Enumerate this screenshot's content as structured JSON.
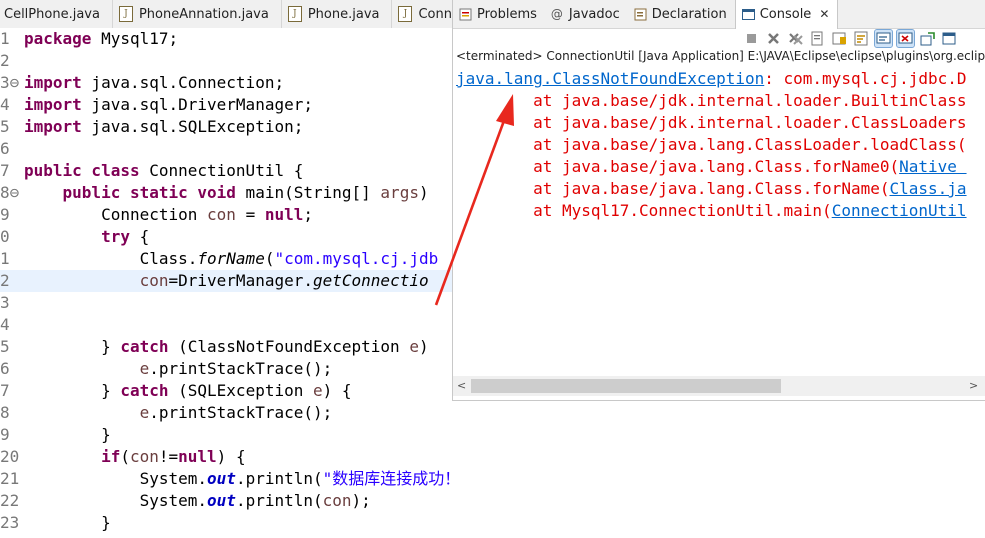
{
  "editor_tabs": [
    "CellPhone.java",
    "PhoneAnnation.java",
    "Phone.java",
    "Conne"
  ],
  "code_lines": [
    {
      "num": "1",
      "html_parts": [
        {
          "t": "kw",
          "v": "package"
        },
        {
          "t": "",
          "v": " Mysql17;"
        }
      ]
    },
    {
      "num": "2",
      "html_parts": []
    },
    {
      "num": "3⊖",
      "html_parts": [
        {
          "t": "kw",
          "v": "import"
        },
        {
          "t": "",
          "v": " java.sql.Connection;"
        }
      ]
    },
    {
      "num": "4",
      "html_parts": [
        {
          "t": "kw",
          "v": "import"
        },
        {
          "t": "",
          "v": " java.sql.DriverManager;"
        }
      ]
    },
    {
      "num": "5",
      "html_parts": [
        {
          "t": "kw",
          "v": "import"
        },
        {
          "t": "",
          "v": " java.sql.SQLException;"
        }
      ]
    },
    {
      "num": "6",
      "html_parts": []
    },
    {
      "num": "7",
      "html_parts": [
        {
          "t": "kw",
          "v": "public class"
        },
        {
          "t": "",
          "v": " ConnectionUtil {"
        }
      ]
    },
    {
      "num": "8⊖",
      "html_parts": [
        {
          "t": "",
          "v": "    "
        },
        {
          "t": "kw",
          "v": "public static void"
        },
        {
          "t": "",
          "v": " main(String[] "
        },
        {
          "t": "var",
          "v": "args"
        },
        {
          "t": "",
          "v": ")"
        }
      ]
    },
    {
      "num": "9",
      "html_parts": [
        {
          "t": "",
          "v": "        Connection "
        },
        {
          "t": "var",
          "v": "con"
        },
        {
          "t": "",
          "v": " = "
        },
        {
          "t": "kw",
          "v": "null"
        },
        {
          "t": "",
          "v": ";"
        }
      ]
    },
    {
      "num": "0",
      "html_parts": [
        {
          "t": "",
          "v": "        "
        },
        {
          "t": "kw",
          "v": "try"
        },
        {
          "t": "",
          "v": " {"
        }
      ]
    },
    {
      "num": "1",
      "html_parts": [
        {
          "t": "",
          "v": "            Class."
        },
        {
          "t": "it",
          "v": "forName"
        },
        {
          "t": "",
          "v": "("
        },
        {
          "t": "str",
          "v": "\"com.mysql.cj.jdb"
        }
      ]
    },
    {
      "num": "2",
      "html_parts": [
        {
          "t": "",
          "v": "            "
        },
        {
          "t": "var",
          "v": "con"
        },
        {
          "t": "",
          "v": "=DriverManager."
        },
        {
          "t": "it",
          "v": "getConnectio"
        }
      ],
      "current": true
    },
    {
      "num": "3",
      "html_parts": []
    },
    {
      "num": "4",
      "html_parts": []
    },
    {
      "num": "5",
      "html_parts": [
        {
          "t": "",
          "v": "        } "
        },
        {
          "t": "kw",
          "v": "catch"
        },
        {
          "t": "",
          "v": " (ClassNotFoundException "
        },
        {
          "t": "var",
          "v": "e"
        },
        {
          "t": "",
          "v": ")"
        }
      ]
    },
    {
      "num": "6",
      "html_parts": [
        {
          "t": "",
          "v": "            "
        },
        {
          "t": "var",
          "v": "e"
        },
        {
          "t": "",
          "v": ".printStackTrace();"
        }
      ]
    },
    {
      "num": "7",
      "html_parts": [
        {
          "t": "",
          "v": "        } "
        },
        {
          "t": "kw",
          "v": "catch"
        },
        {
          "t": "",
          "v": " (SQLException "
        },
        {
          "t": "var",
          "v": "e"
        },
        {
          "t": "",
          "v": ") {"
        }
      ]
    },
    {
      "num": "8",
      "html_parts": [
        {
          "t": "",
          "v": "            "
        },
        {
          "t": "var",
          "v": "e"
        },
        {
          "t": "",
          "v": ".printStackTrace();"
        }
      ]
    },
    {
      "num": "9",
      "html_parts": [
        {
          "t": "",
          "v": "        }"
        }
      ]
    },
    {
      "num": "20",
      "html_parts": [
        {
          "t": "",
          "v": "        "
        },
        {
          "t": "kw",
          "v": "if"
        },
        {
          "t": "",
          "v": "("
        },
        {
          "t": "var",
          "v": "con"
        },
        {
          "t": "",
          "v": "!="
        },
        {
          "t": "kw",
          "v": "null"
        },
        {
          "t": "",
          "v": ") {"
        }
      ]
    },
    {
      "num": "21",
      "html_parts": [
        {
          "t": "",
          "v": "            System."
        },
        {
          "t": "fld",
          "v": "out"
        },
        {
          "t": "",
          "v": ".println("
        },
        {
          "t": "str",
          "v": "\"数据库连接成功！\""
        },
        {
          "t": "",
          "v": ");"
        }
      ]
    },
    {
      "num": "22",
      "html_parts": [
        {
          "t": "",
          "v": "            System."
        },
        {
          "t": "fld",
          "v": "out"
        },
        {
          "t": "",
          "v": ".println("
        },
        {
          "t": "var",
          "v": "con"
        },
        {
          "t": "",
          "v": ");"
        }
      ]
    },
    {
      "num": "23",
      "html_parts": [
        {
          "t": "",
          "v": "        }"
        }
      ]
    },
    {
      "num": "",
      "html_parts": [
        {
          "t": "",
          "v": "    }"
        }
      ]
    }
  ],
  "console_tabs": {
    "problems": "Problems",
    "javadoc": "Javadoc",
    "declaration": "Declaration",
    "console": "Console",
    "close": "✕"
  },
  "console": {
    "terminated": "<terminated> ConnectionUtil [Java Application] E:\\JAVA\\Eclipse\\eclipse\\plugins\\org.eclipse.",
    "lines": [
      [
        {
          "t": "lnk",
          "v": "java.lang.ClassNotFoundException"
        },
        {
          "t": "",
          "v": ": com.mysql.cj.jdbc.D"
        }
      ],
      [
        {
          "t": "",
          "v": "\tat java.base/jdk.internal.loader.BuiltinClass"
        }
      ],
      [
        {
          "t": "",
          "v": "\tat java.base/jdk.internal.loader.ClassLoaders"
        }
      ],
      [
        {
          "t": "",
          "v": "\tat java.base/java.lang.ClassLoader.loadClass("
        }
      ],
      [
        {
          "t": "",
          "v": "\tat java.base/java.lang.Class.forName0("
        },
        {
          "t": "lnk",
          "v": "Native "
        }
      ],
      [
        {
          "t": "",
          "v": "\tat java.base/java.lang.Class.forName("
        },
        {
          "t": "lnk",
          "v": "Class.ja"
        }
      ],
      [
        {
          "t": "",
          "v": "\tat Mysql17.ConnectionUtil.main("
        },
        {
          "t": "lnk",
          "v": "ConnectionUtil"
        }
      ]
    ]
  },
  "colors": {
    "keyword": "#7f0055",
    "string": "#2a00ff",
    "error": "#e00000",
    "link": "#0066cc",
    "annotation_arrow": "#e8281e"
  }
}
